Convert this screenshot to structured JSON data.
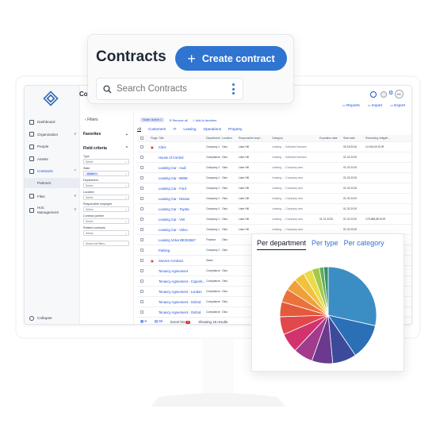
{
  "app": {
    "title": "Co",
    "sidebar": {
      "items": [
        {
          "label": "Dashboard",
          "icon": "dashboard-icon"
        },
        {
          "label": "Organization",
          "icon": "organization-icon",
          "chevron": "v"
        },
        {
          "label": "People",
          "icon": "people-icon"
        },
        {
          "label": "Assets",
          "icon": "assets-icon"
        },
        {
          "label": "Contracts",
          "icon": "contracts-icon",
          "chevron": "^",
          "active": true
        },
        {
          "label": "Files",
          "icon": "files-icon",
          "chevron": "v"
        },
        {
          "label": "HoC Management",
          "icon": "management-icon",
          "chevron": "v"
        }
      ],
      "sub_item": "Partners",
      "collapse": "Collapse"
    },
    "avatar": "HC",
    "actions": [
      "Reports",
      "Import",
      "Export"
    ],
    "filters": {
      "title": "Filters",
      "favorites": "Favorites",
      "field_criteria": "Field criteria",
      "fields": [
        {
          "label": "Type",
          "value": "Select"
        },
        {
          "label": "State",
          "value": "Active",
          "chip": true
        },
        {
          "label": "Department",
          "value": "Select"
        },
        {
          "label": "Location",
          "value": "Select"
        },
        {
          "label": "Responsible employee",
          "value": "Select"
        },
        {
          "label": "Contract partner",
          "value": "Select"
        },
        {
          "label": "Related contracts",
          "value": "Select"
        }
      ],
      "search_all": "Search all filters..."
    },
    "chips": {
      "status": "State: Active 1",
      "remove_all": "Remove all",
      "add_fav": "Add to favorites"
    },
    "tabs": [
      "All",
      "Customers",
      "IT",
      "Leasing",
      "Operations",
      "Property"
    ],
    "table": {
      "headers": [
        "Flags",
        "Title",
        "Department",
        "Location",
        "Responsible empl...",
        "Category",
        "Expiration date",
        "Start date",
        "Remaining obligati..."
      ],
      "rows": [
        {
          "flag": "▣",
          "title": "Citrix",
          "dept": "Company 1",
          "loc": "Oslo",
          "resp": "Liam Hill",
          "cat": "Leasing → Software licenses",
          "exp": "",
          "start": "05.18.2016",
          "rem": "14.916,00 EUR"
        },
        {
          "flag": "",
          "title": "House of Control",
          "dept": "Compliance",
          "loc": "Oslo",
          "resp": "Liam Hill",
          "cat": "Leasing → Software licenses",
          "exp": "",
          "start": "01.01.2019",
          "rem": ""
        },
        {
          "flag": "",
          "title": "Leasing Car - Audi",
          "dept": "Company 1",
          "loc": "Oslo",
          "resp": "Liam Hill",
          "cat": "Leasing → Company cars",
          "exp": "",
          "start": "01.02.2019",
          "rem": ""
        },
        {
          "flag": "",
          "title": "Leasing Car - BMW",
          "dept": "Company 1",
          "loc": "Oslo",
          "resp": "Liam Hill",
          "cat": "Leasing → Company cars",
          "exp": "",
          "start": "01.02.2019",
          "rem": ""
        },
        {
          "flag": "",
          "title": "Leasing Car - Ford",
          "dept": "Company 1",
          "loc": "Oslo",
          "resp": "Liam Hill",
          "cat": "Leasing → Company cars",
          "exp": "",
          "start": "01.02.2018",
          "rem": ""
        },
        {
          "flag": "",
          "title": "Leasing Car - Nissan",
          "dept": "Company 1",
          "loc": "Oslo",
          "resp": "Liam Hill",
          "cat": "Leasing → Company cars",
          "exp": "",
          "start": "01.02.2019",
          "rem": ""
        },
        {
          "flag": "",
          "title": "Leasing Car - Toyota",
          "dept": "Company 1",
          "loc": "Oslo",
          "resp": "Liam Hill",
          "cat": "Leasing → Company cars",
          "exp": "",
          "start": "01.02.2019",
          "rem": ""
        },
        {
          "flag": "",
          "title": "Leasing Car - VW",
          "dept": "Company 1",
          "loc": "Oslo",
          "resp": "Liam Hill",
          "cat": "Leasing → Company cars",
          "exp": "01.01.2025",
          "start": "01.02.2019",
          "rem": "175.888,88 EUR"
        },
        {
          "flag": "",
          "title": "Leasing Car - Volvo",
          "dept": "Company 1",
          "loc": "Oslo",
          "resp": "Liam Hill",
          "cat": "Leasing → Company cars",
          "exp": "",
          "start": "01.02.2019",
          "rem": ""
        },
        {
          "flag": "",
          "title": "Leasing Volvo BE334567",
          "dept": "Finance",
          "loc": "Oslo",
          "resp": "",
          "cat": "",
          "exp": "",
          "start": "",
          "rem": ""
        },
        {
          "flag": "",
          "title": "Parking",
          "dept": "Company 1",
          "loc": "Oslo",
          "resp": "",
          "cat": "",
          "exp": "",
          "start": "",
          "rem": ""
        },
        {
          "flag": "▣",
          "title": "Service Contract",
          "dept": "Sales",
          "loc": "",
          "resp": "",
          "cat": "",
          "exp": "",
          "start": "",
          "rem": ""
        },
        {
          "flag": "",
          "title": "Tenancy Agreement",
          "dept": "Compliance",
          "loc": "Oslo",
          "resp": "",
          "cat": "",
          "exp": "",
          "start": "",
          "rem": ""
        },
        {
          "flag": "",
          "title": "Tenancy Agreement - Copenh...",
          "dept": "Compliance",
          "loc": "Oslo",
          "resp": "",
          "cat": "",
          "exp": "",
          "start": "",
          "rem": ""
        },
        {
          "flag": "",
          "title": "Tenancy Agreement - London",
          "dept": "Compliance",
          "loc": "Oslo",
          "resp": "",
          "cat": "",
          "exp": "",
          "start": "",
          "rem": ""
        },
        {
          "flag": "",
          "title": "Tenancy Agreement - Oxford",
          "dept": "Compliance",
          "loc": "Oslo",
          "resp": "",
          "cat": "",
          "exp": "",
          "start": "",
          "rem": ""
        },
        {
          "flag": "",
          "title": "Tenancy Agreement - Oxford",
          "dept": "Compliance",
          "loc": "Oslo",
          "resp": "",
          "cat": "",
          "exp": "",
          "start": "",
          "rem": ""
        }
      ]
    },
    "footer": {
      "count_a": "9",
      "count_b": "50",
      "event_list": "Event list",
      "event_badge": "2",
      "results": "Showing 18 results"
    }
  },
  "header_card": {
    "title": "Contracts",
    "create_label": "Create contract",
    "search_placeholder": "Search Contracts"
  },
  "pie_card": {
    "tabs": [
      "Per department",
      "Per type",
      "Per category"
    ],
    "active_tab": 0
  },
  "chart_data": {
    "type": "pie",
    "values": [
      28.5,
      12,
      8,
      7,
      6.5,
      6.5,
      6,
      5,
      4.5,
      4,
      3.5,
      3,
      2.5,
      1.5,
      1.5
    ],
    "colors": [
      "#3b8ec4",
      "#2b6fb6",
      "#3d4a9c",
      "#6b3a8e",
      "#a13b8c",
      "#d2336e",
      "#e2474b",
      "#e35a3a",
      "#e9733a",
      "#f0a03a",
      "#f1c23d",
      "#eadb4a",
      "#a3c94b",
      "#5fae57",
      "#3c8d6e"
    ]
  },
  "colors": {
    "brand_blue": "#2f74d0",
    "link_blue": "#1d4ed8",
    "sidebar_bg": "#f7f8fa"
  }
}
